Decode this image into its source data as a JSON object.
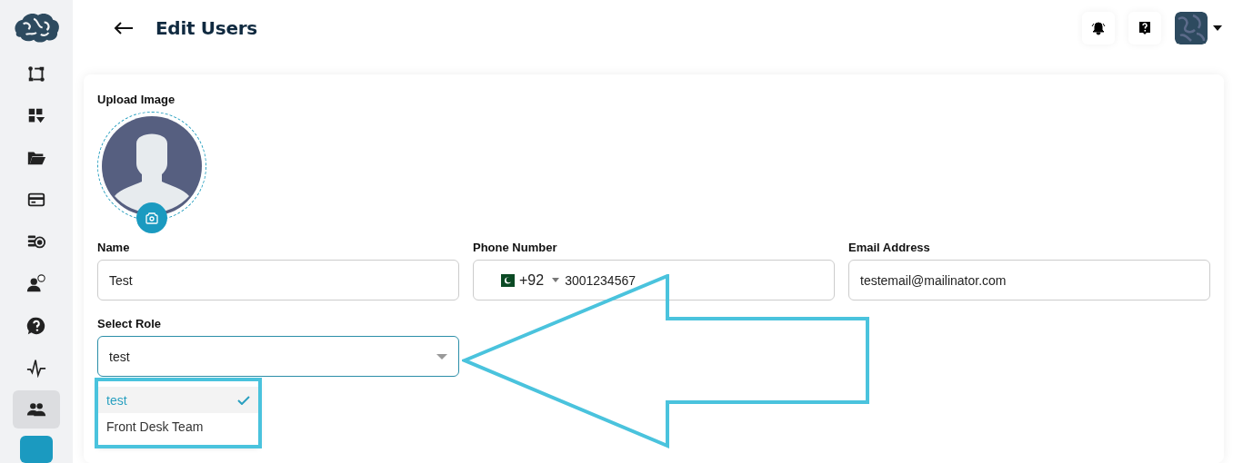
{
  "sidebar": {
    "items": [
      {
        "selected": false
      },
      {
        "selected": false
      },
      {
        "selected": false
      },
      {
        "selected": false
      },
      {
        "selected": false
      },
      {
        "selected": false
      },
      {
        "selected": false
      },
      {
        "selected": false
      },
      {
        "selected": true
      }
    ]
  },
  "header": {
    "title": "Edit Users"
  },
  "form": {
    "upload_label": "Upload Image",
    "name": {
      "label": "Name",
      "value": "Test"
    },
    "phone": {
      "label": "Phone Number",
      "country_code": "+92",
      "value": "3001234567"
    },
    "email": {
      "label": "Email Address",
      "value": "testemail@mailinator.com"
    },
    "role": {
      "label": "Select Role",
      "value": "test",
      "expanded": true,
      "options": [
        {
          "label": "test",
          "selected": true
        },
        {
          "label": "Front Desk Team",
          "selected": false
        }
      ]
    }
  }
}
